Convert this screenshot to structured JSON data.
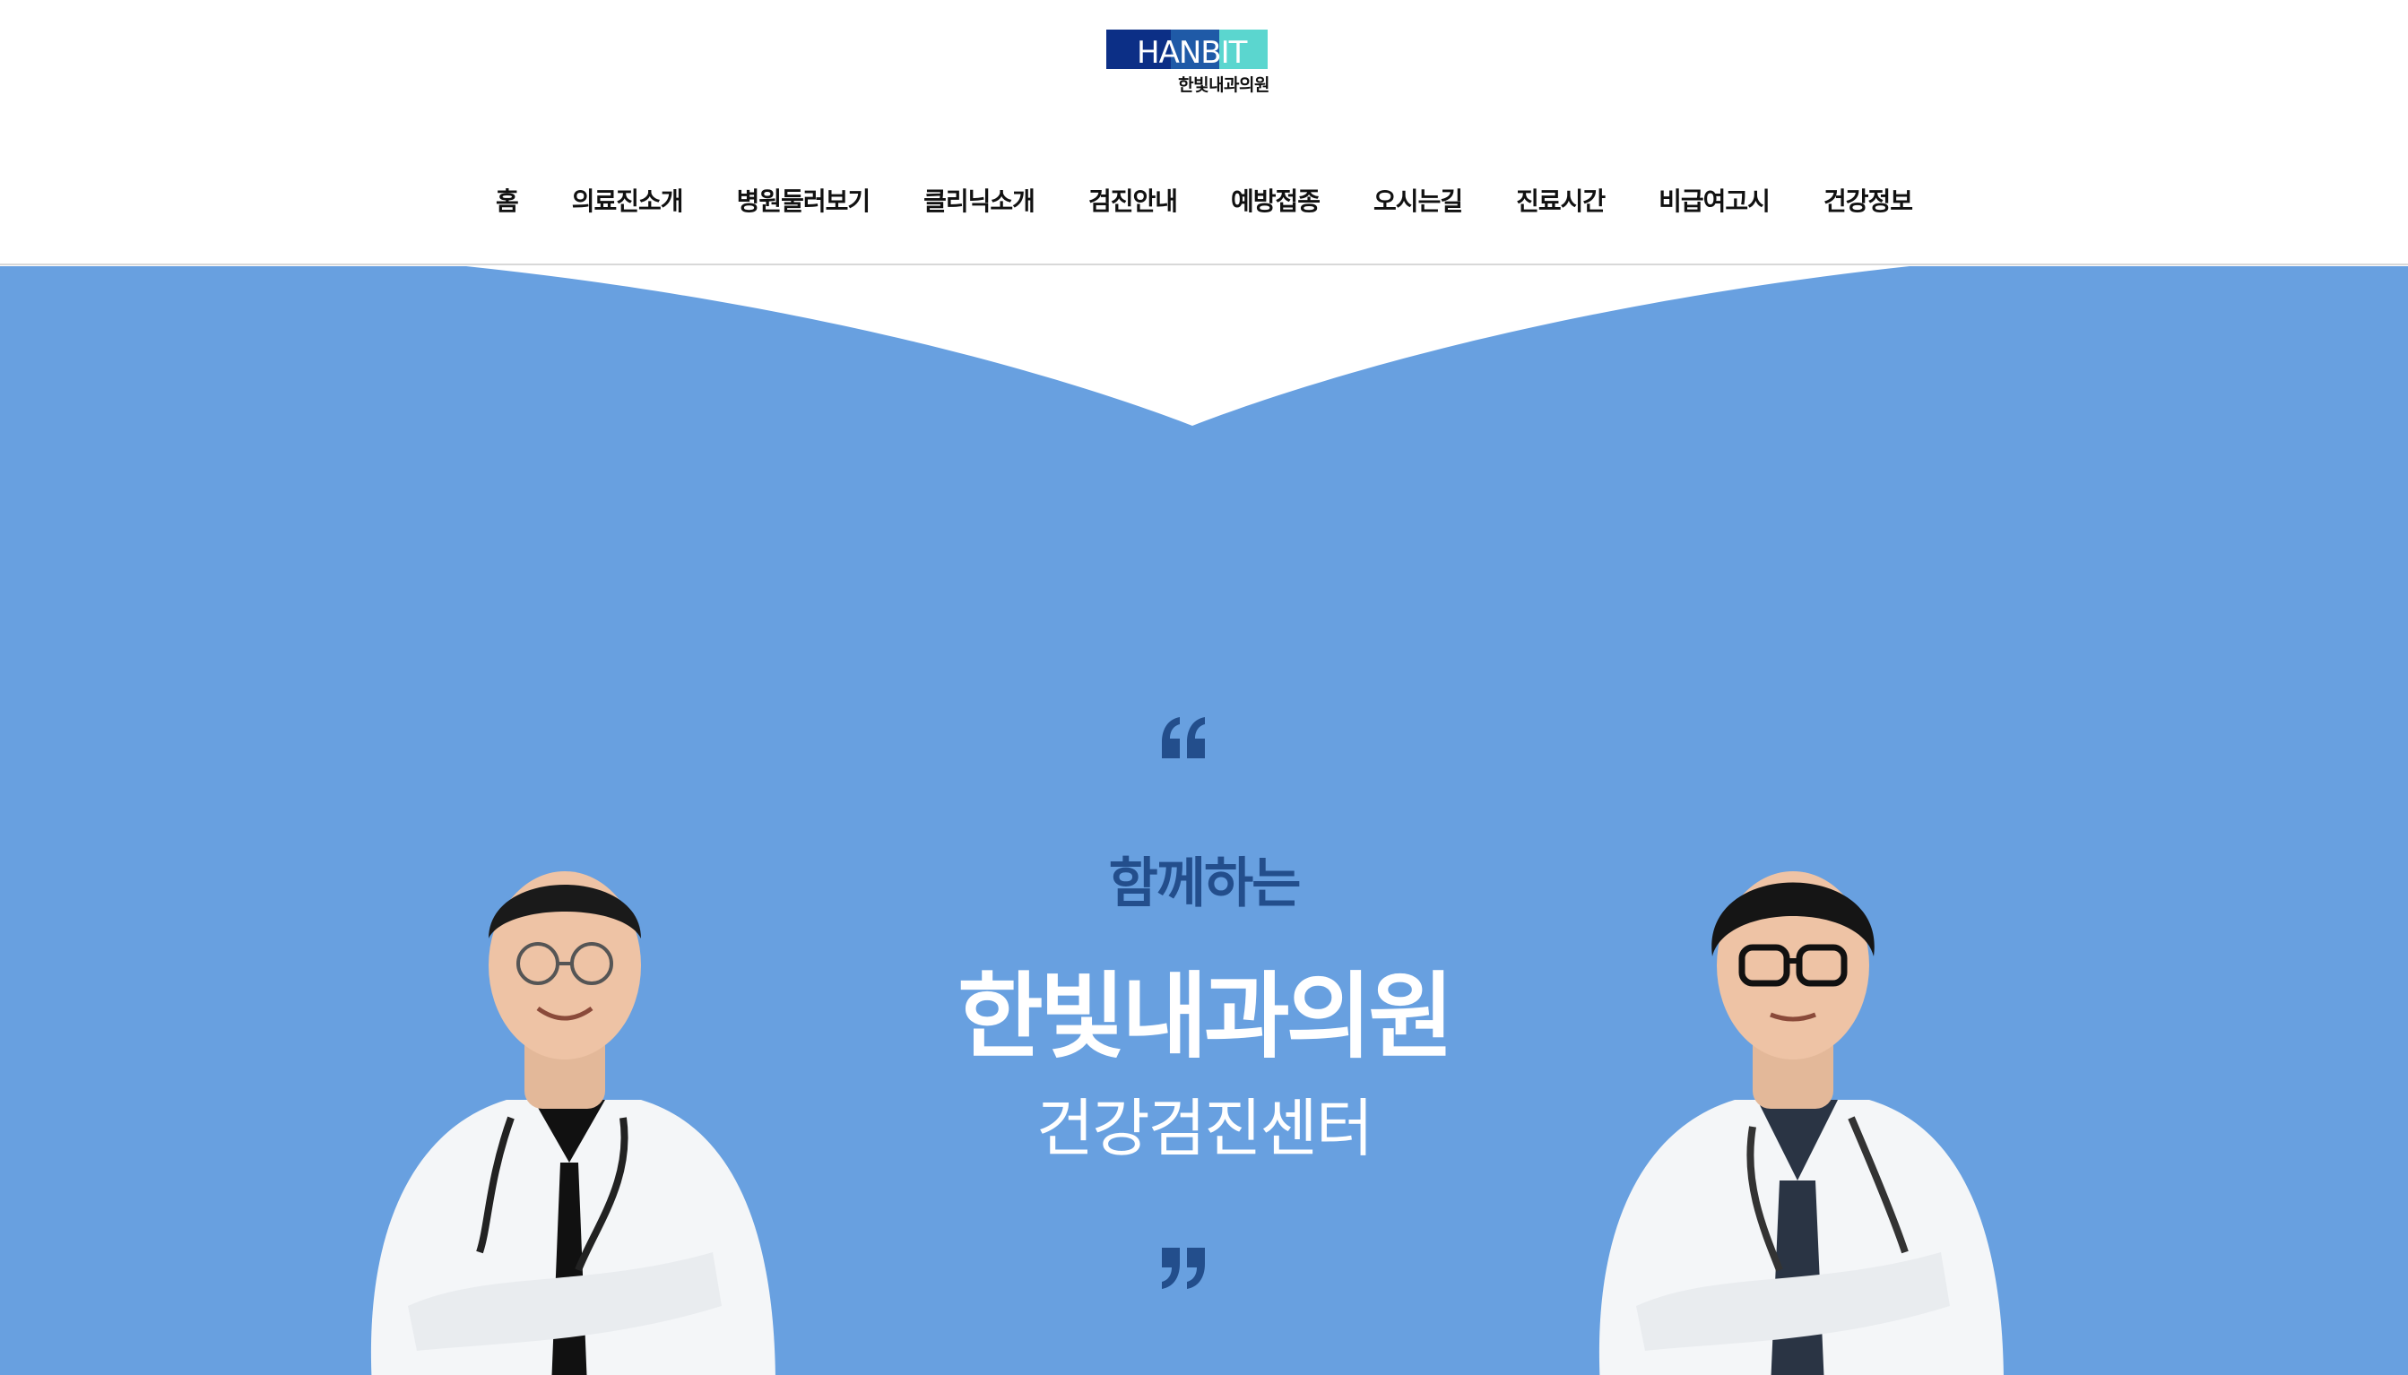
{
  "logo": {
    "word": "HANBIT",
    "subtitle": "한빛내과의원"
  },
  "nav": {
    "items": [
      "홈",
      "의료진소개",
      "병원둘러보기",
      "클리닉소개",
      "검진안내",
      "예방접종",
      "오시는길",
      "진료시간",
      "비급여고시",
      "건강정보"
    ]
  },
  "hero": {
    "sub1": "함께하는",
    "title": "한빛내과의원",
    "sub2": "건강검진센터",
    "quote_open_icon": "quote-open-icon",
    "quote_close_icon": "quote-close-icon"
  },
  "colors": {
    "hero_bg": "#68a0e0",
    "sub1_text": "#234e8c",
    "quote_marks": "#234e8c",
    "logo_navy": "#0c2f86",
    "logo_blue": "#1f5aa7",
    "logo_mint": "#5bd6cf"
  }
}
